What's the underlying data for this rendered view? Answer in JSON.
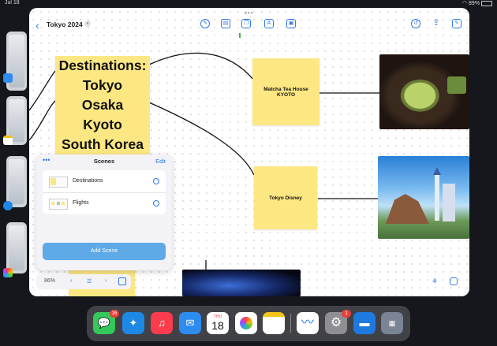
{
  "status_bar": {
    "time": "Jul 18",
    "battery": "89%"
  },
  "window": {
    "title": "Tokyo 2024",
    "toolbar_icons": [
      "pen-icon",
      "text-box-icon",
      "shapes-icon",
      "text-icon",
      "media-icon"
    ],
    "right_icons": [
      "undo-icon",
      "share-icon",
      "compose-icon"
    ]
  },
  "canvas": {
    "destinations_note": [
      "Destinations:",
      "Tokyo",
      "Osaka",
      "Kyoto",
      "South Korea"
    ],
    "matcha_note": [
      "Matcha Tea House",
      "KYOTO"
    ],
    "disney_note": "Tokyo Disney"
  },
  "scenes_panel": {
    "title": "Scenes",
    "edit_label": "Edit",
    "items": [
      {
        "label": "Destinations"
      },
      {
        "label": "Flights"
      }
    ],
    "add_label": "Add Scene"
  },
  "bottom_bar": {
    "zoom": "86%"
  },
  "dock": {
    "apps": [
      {
        "name": "messages-icon",
        "color": "#34c759",
        "badge": "16"
      },
      {
        "name": "safari-icon",
        "color": "#1e88e5",
        "badge": ""
      },
      {
        "name": "music-icon",
        "color": "#fa3c4c",
        "badge": ""
      },
      {
        "name": "mail-icon",
        "color": "#2d8cf0",
        "badge": ""
      },
      {
        "name": "calendar-icon",
        "color": "#ffffff",
        "badge": ""
      },
      {
        "name": "photos-icon",
        "color": "#ffffff",
        "badge": ""
      },
      {
        "name": "notes-icon",
        "color": "#ffffff",
        "badge": ""
      },
      {
        "name": "freeform-icon",
        "color": "#ffffff",
        "badge": ""
      },
      {
        "name": "settings-icon",
        "color": "#8e8e93",
        "badge": "1"
      },
      {
        "name": "files-icon",
        "color": "#1f7ae0",
        "badge": ""
      },
      {
        "name": "app-library-icon",
        "color": "#7b8494",
        "badge": ""
      }
    ],
    "calendar": {
      "day": "THU",
      "date": "18"
    }
  }
}
